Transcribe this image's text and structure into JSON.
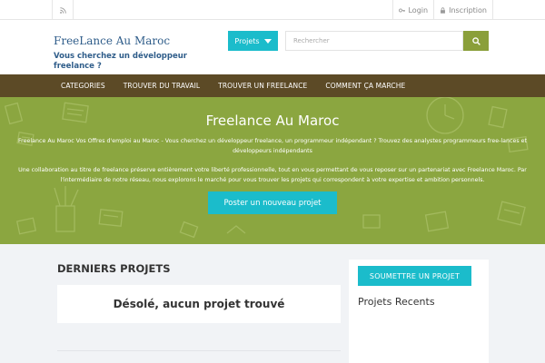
{
  "topbar": {
    "rss_icon": "rss-icon",
    "login_label": "Login",
    "inscription_label": "Inscription"
  },
  "header": {
    "logo": "FreeLance Au Maroc",
    "tagline": "Vous cherchez un développeur freelance ?",
    "projects_label": "Projets",
    "search_placeholder": "Rechercher"
  },
  "nav": {
    "items": [
      "CATEGORIES",
      "TROUVER DU TRAVAIL",
      "TROUVER UN FREELANCE",
      "COMMENT ÇA MARCHE"
    ]
  },
  "hero": {
    "title": "Freelance Au Maroc",
    "text1": "Freelance Au Maroc Vos Offres d'emploi au Maroc - Vous cherchez un développeur freelance, un programmeur indépendant ? Trouvez des analystes programmeurs free-lances et développeurs indépendants",
    "text2": "Une collaboration au titre de freelance préserve entièrement votre liberté professionnelle, tout en vous permettant de vous reposer sur un partenariat avec Freelance Maroc. Par l'intermédiaire de notre réseau, nous explorons le marché pour vous trouver les projets qui correspondent à votre expertise et ambition personnels.",
    "cta": "Poster un nouveau projet"
  },
  "main": {
    "section_title": "DERNIERS PROJETS",
    "empty_message": "Désolé, aucun projet trouvé"
  },
  "sidebar": {
    "submit_label": "SOUMETTRE UN PROJET",
    "recent_title": "Projets Recents"
  },
  "colors": {
    "accent": "#1bbccb",
    "nav_bg": "#5c4a26",
    "hero_bg": "#8ba640",
    "search_btn": "#8a9f3a",
    "brand_text": "#2f5d8a"
  }
}
